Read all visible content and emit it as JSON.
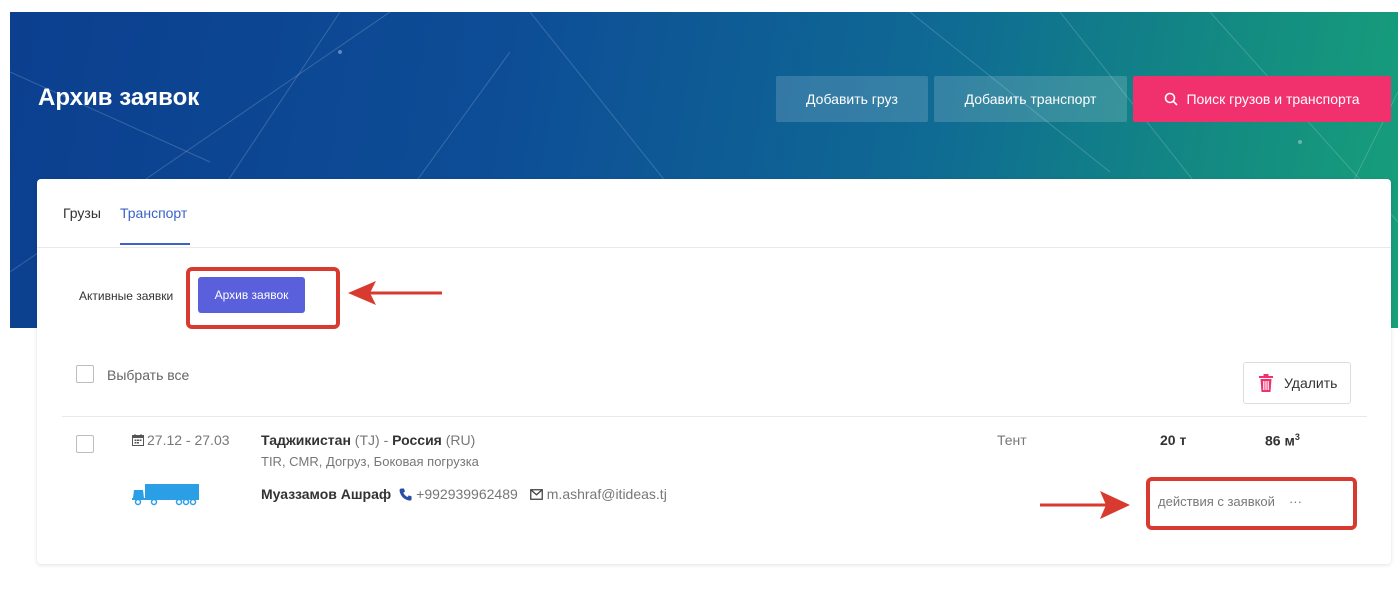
{
  "header": {
    "title": "Архив заявок",
    "add_cargo": "Добавить груз",
    "add_transport": "Добавить транспорт",
    "search": "Поиск грузов и транспорта",
    "accent_color": "#f0316d"
  },
  "tabs": [
    {
      "label": "Грузы",
      "active": false
    },
    {
      "label": "Транспорт",
      "active": true
    }
  ],
  "segment": {
    "active_requests": "Активные заявки",
    "archive_requests": "Архив заявок"
  },
  "toolbar": {
    "select_all": "Выбрать все",
    "delete": "Удалить"
  },
  "rows": [
    {
      "dates": "27.12 - 27.03",
      "from_country": "Таджикистан",
      "from_code": "(TJ)",
      "sep": "-",
      "to_country": "Россия",
      "to_code": "(RU)",
      "features": "TIR, CMR, Догруз, Боковая погрузка",
      "body_type": "Тент",
      "weight": "20 т",
      "volume": "86 м",
      "volume_sup": "3",
      "contact_name": "Муаззамов Ашраф",
      "phone": "+992939962489",
      "email": "m.ashraf@itideas.tj",
      "actions": "действия с заявкой",
      "more": "···"
    }
  ]
}
